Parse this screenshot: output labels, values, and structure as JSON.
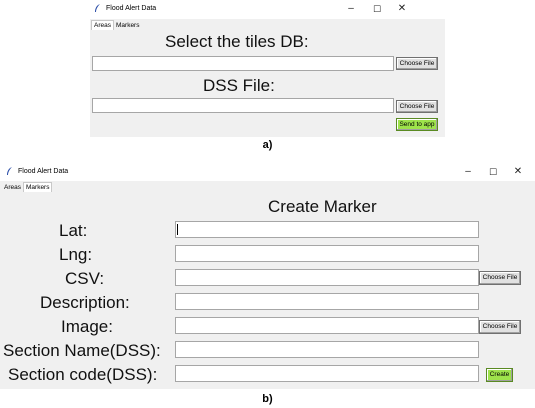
{
  "panel_a": {
    "window_title": "Flood Alert Data",
    "controls": {
      "minimize": "–",
      "maximize": "☐",
      "close": "✕"
    },
    "tabs": [
      {
        "label": "Areas",
        "active": true
      },
      {
        "label": "Markers",
        "active": false
      }
    ],
    "tiles_heading": "Select the tiles DB:",
    "tiles_path": "",
    "tiles_button": "Choose File",
    "dss_heading": "DSS File:",
    "dss_path": "",
    "dss_button": "Choose File",
    "send_button": "Send to app",
    "caption": "a)"
  },
  "panel_b": {
    "window_title": "Flood Alert Data",
    "controls": {
      "minimize": "–",
      "maximize": "☐",
      "close": "✕"
    },
    "tabs": [
      {
        "label": "Areas",
        "active": false
      },
      {
        "label": "Markers",
        "active": true
      }
    ],
    "heading": "Create Marker",
    "fields": [
      {
        "label": "Lat:",
        "value": ""
      },
      {
        "label": "Lng:",
        "value": ""
      },
      {
        "label": "CSV:",
        "value": ""
      },
      {
        "label": "Description:",
        "value": ""
      },
      {
        "label": "Image:",
        "value": ""
      },
      {
        "label": "Section Name(DSS):",
        "value": ""
      },
      {
        "label": "Section code(DSS):",
        "value": ""
      }
    ],
    "csv_button": "Choose File",
    "image_button": "Choose File",
    "create_button": "Create",
    "caption": "b)"
  },
  "colors": {
    "window_bg": "#f0f0f0",
    "send_button_bg": "#9ee34b",
    "create_button_bg": "#9ee34b"
  }
}
